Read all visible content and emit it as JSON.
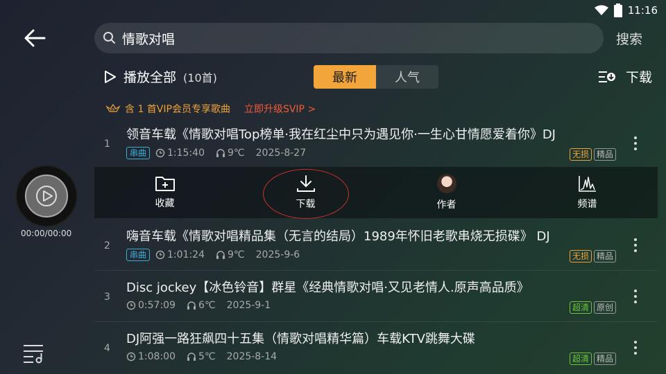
{
  "status": {
    "time": "11:16",
    "icons": [
      "wifi-icon",
      "battery-icon"
    ]
  },
  "search": {
    "value": "情歌对唱",
    "button_label": "搜索"
  },
  "toolbar": {
    "play_all_label": "播放全部",
    "count": "(10首)",
    "tabs": [
      {
        "label": "最新",
        "active": true
      },
      {
        "label": "人气",
        "active": false
      }
    ],
    "download_label": "下载"
  },
  "vip_notice": {
    "text": "含 1 首VIP会员专享歌曲",
    "upgrade": "立即升级SVIP >"
  },
  "songs": [
    {
      "index": "1",
      "title": "领音车载《情歌对唱Top榜单·我在红尘中只为遇见你·一生心甘情愿爱着你》DJ",
      "tag": "串曲",
      "duration": "1:15:40",
      "temp": "9℃",
      "date": "2025-8-27",
      "badges": [
        "无损",
        "精品"
      ]
    },
    {
      "index": "2",
      "title": "嗨音车载《情歌对唱精品集（无言的结局）1989年怀旧老歌串烧无损碟》 DJ",
      "tag": "串曲",
      "duration": "1:01:24",
      "temp": "9℃",
      "date": "2025-9-6",
      "badges": [
        "无损",
        "精品"
      ]
    },
    {
      "index": "3",
      "title": "Disc jockey【冰色铃音】群星《经典情歌对唱·又见老情人.原声高品质》",
      "tag": "",
      "duration": "0:57:09",
      "temp": "6℃",
      "date": "2025-9-1",
      "badges": [
        "超清",
        "原创"
      ]
    },
    {
      "index": "4",
      "title": "DJ阿强一路狂飙四十五集（情歌对唱精华篇）车载KTV跳舞大碟",
      "tag": "",
      "duration": "1:08:00",
      "temp": "5℃",
      "date": "2025-8-14",
      "badges": [
        "超清",
        "精品"
      ]
    }
  ],
  "actions": [
    {
      "label": "收藏",
      "icon": "add-folder-icon"
    },
    {
      "label": "下载",
      "icon": "download-icon"
    },
    {
      "label": "作者",
      "icon": "avatar-icon"
    },
    {
      "label": "频谱",
      "icon": "spectrum-icon"
    }
  ],
  "player": {
    "time": "00:00/00:00"
  },
  "colors": {
    "accent": "#f2a53a",
    "vip": "#f0a23a",
    "upgrade": "#f55a3a",
    "tag_blue": "#3aaed8",
    "badge_green": "#6ac83a"
  }
}
